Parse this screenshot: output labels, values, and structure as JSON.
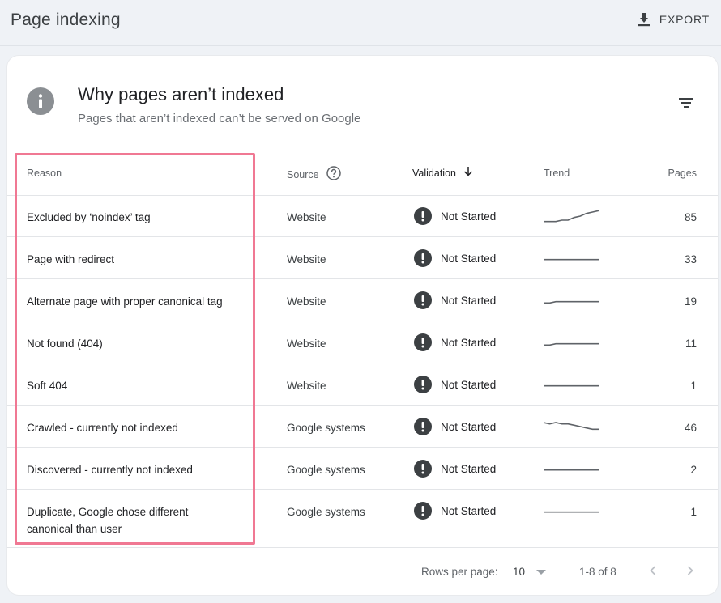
{
  "header": {
    "title": "Page indexing",
    "export_label": "EXPORT"
  },
  "card": {
    "title": "Why pages aren’t indexed",
    "subtitle": "Pages that aren’t indexed can’t be served on Google"
  },
  "table": {
    "columns": {
      "reason": "Reason",
      "source": "Source",
      "validation": "Validation",
      "trend": "Trend",
      "pages": "Pages"
    },
    "rows": [
      {
        "reason": "Excluded by ‘noindex’ tag",
        "source": "Website",
        "validation": "Not Started",
        "pages": "85",
        "trend": [
          2,
          2,
          2,
          3,
          3,
          5,
          6,
          8,
          9,
          10
        ]
      },
      {
        "reason": "Page with redirect",
        "source": "Website",
        "validation": "Not Started",
        "pages": "33",
        "trend": [
          5,
          5,
          5,
          5,
          5,
          5,
          5,
          5,
          5,
          5
        ]
      },
      {
        "reason": "Alternate page with proper canonical tag",
        "source": "Website",
        "validation": "Not Started",
        "pages": "19",
        "trend": [
          4,
          4,
          5,
          5,
          5,
          5,
          5,
          5,
          5,
          5
        ]
      },
      {
        "reason": "Not found (404)",
        "source": "Website",
        "validation": "Not Started",
        "pages": "11",
        "trend": [
          4,
          4,
          5,
          5,
          5,
          5,
          5,
          5,
          5,
          5
        ]
      },
      {
        "reason": "Soft 404",
        "source": "Website",
        "validation": "Not Started",
        "pages": "1",
        "trend": [
          5,
          5,
          5,
          5,
          5,
          5,
          5,
          5,
          5,
          5
        ]
      },
      {
        "reason": "Crawled - currently not indexed",
        "source": "Google systems",
        "validation": "Not Started",
        "pages": "46",
        "trend": [
          9,
          8,
          9,
          8,
          8,
          7,
          6,
          5,
          4,
          4
        ]
      },
      {
        "reason": "Discovered - currently not indexed",
        "source": "Google systems",
        "validation": "Not Started",
        "pages": "2",
        "trend": [
          5,
          5,
          5,
          5,
          5,
          5,
          5,
          5,
          5,
          5
        ]
      },
      {
        "reason": "Duplicate, Google chose different canonical than user",
        "source": "Google systems",
        "validation": "Not Started",
        "pages": "1",
        "trend": [
          5,
          5,
          5,
          5,
          5,
          5,
          5,
          5,
          5,
          5
        ]
      }
    ]
  },
  "pagination": {
    "rows_per_page_label": "Rows per page:",
    "rows_per_page_value": "10",
    "range": "1-8 of 8"
  },
  "colors": {
    "highlight": "#f07893",
    "trend_line": "#5f6368",
    "status_icon": "#3c4043"
  },
  "icons": [
    "download-icon",
    "info-icon",
    "filter-icon",
    "help-icon",
    "arrow-down-icon",
    "warning-icon",
    "caret-down-icon",
    "chevron-left-icon",
    "chevron-right-icon"
  ]
}
